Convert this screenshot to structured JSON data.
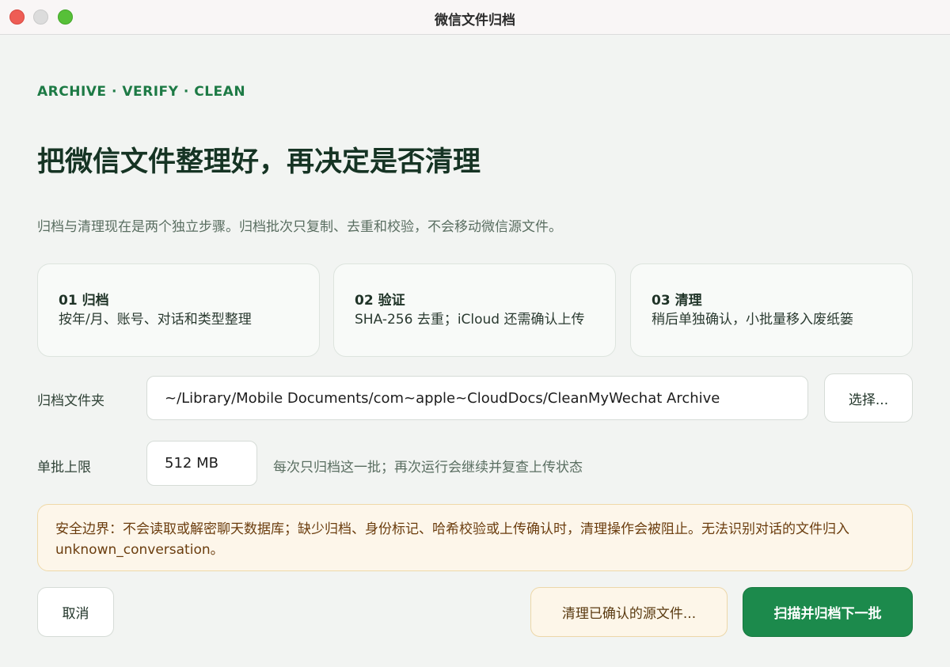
{
  "window": {
    "title": "微信文件归档"
  },
  "header": {
    "eyebrow": "ARCHIVE · VERIFY · CLEAN",
    "headline": "把微信文件整理好，再决定是否清理",
    "subtitle": "归档与清理现在是两个独立步骤。归档批次只复制、去重和校验，不会移动微信源文件。"
  },
  "steps": [
    {
      "title": "01 归档",
      "desc": "按年/月、账号、对话和类型整理"
    },
    {
      "title": "02 验证",
      "desc": "SHA-256 去重；iCloud 还需确认上传"
    },
    {
      "title": "03 清理",
      "desc": "稍后单独确认，小批量移入废纸篓"
    }
  ],
  "archive_folder": {
    "label": "归档文件夹",
    "value": "~/Library/Mobile Documents/com~apple~CloudDocs/CleanMyWechat Archive",
    "choose_button": "选择..."
  },
  "batch_limit": {
    "label": "单批上限",
    "value": "512 MB",
    "hint": "每次只归档这一批；再次运行会继续并复查上传状态"
  },
  "warning": {
    "text": "安全边界：不会读取或解密聊天数据库；缺少归档、身份标记、哈希校验或上传确认时，清理操作会被阻止。无法识别对话的文件归入 unknown_conversation。"
  },
  "actions": {
    "cancel": "取消",
    "clean": "清理已确认的源文件...",
    "scan": "扫描并归档下一批"
  },
  "colors": {
    "accent": "#1c8a4c",
    "warning_bg": "#fdf6ea",
    "warning_text": "#6b3d0e"
  }
}
